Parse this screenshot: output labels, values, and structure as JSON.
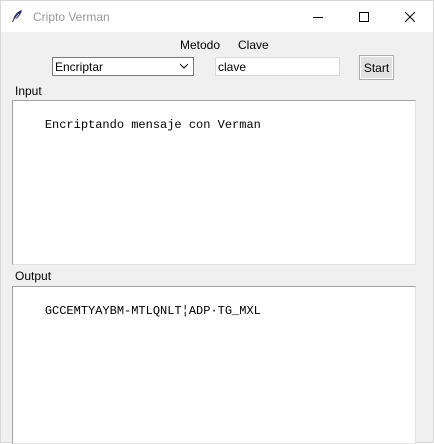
{
  "window": {
    "title": "Cripto Verman",
    "icons": {
      "app": "feather-icon",
      "minimize": "minimize-icon",
      "maximize": "maximize-icon",
      "close": "close-icon"
    }
  },
  "toolbar": {
    "metodo_label": "Metodo",
    "clave_label": "Clave",
    "method_selected": "Encriptar",
    "key_value": "clave",
    "start_label": "Start"
  },
  "input": {
    "label": "Input",
    "text": "Encriptando mensaje con Verman"
  },
  "output": {
    "label": "Output",
    "text": "GCCEMTYAYBM-MTLQNLT¦ADP·TG_MXL"
  }
}
